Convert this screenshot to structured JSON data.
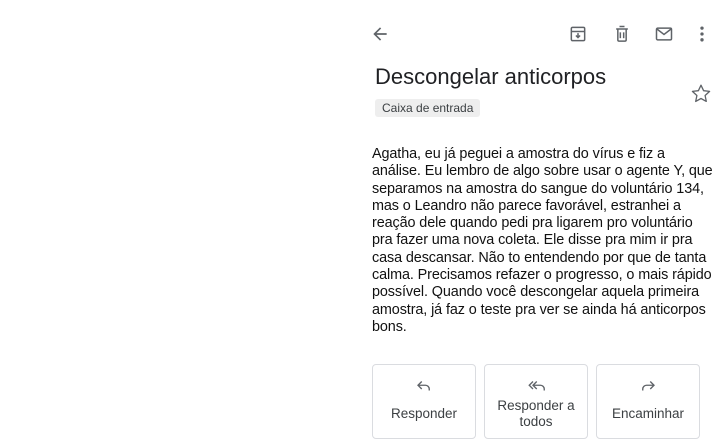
{
  "email": {
    "subject": "Descongelar anticorpos",
    "label": "Caixa de entrada",
    "body": "Agatha, eu já peguei a amostra do vírus e fiz a análise. Eu lembro de algo sobre usar o agente Y, que separamos na amostra do sangue do voluntário 134, mas o Leandro não parece favorável, estranhei a reação dele quando pedi pra ligarem pro voluntário pra fazer uma nova coleta. Ele disse pra mim ir pra casa descansar. Não to entendendo por que de tanta calma. Precisamos refazer o progresso, o mais rápido possível. Quando você descongelar aquela primeira amostra, já faz o teste pra ver se ainda há anticorpos bons."
  },
  "toolbar": {
    "icons": [
      "back-arrow-icon",
      "archive-icon",
      "trash-icon",
      "mail-icon",
      "more-vert-icon"
    ]
  },
  "actions": {
    "reply": "Responder",
    "reply_all": "Responder a todos",
    "forward": "Encaminhar"
  },
  "colors": {
    "icon": "#5f6368",
    "chip_bg": "#eeeeee",
    "border": "#dadce0",
    "text": "#202124"
  }
}
